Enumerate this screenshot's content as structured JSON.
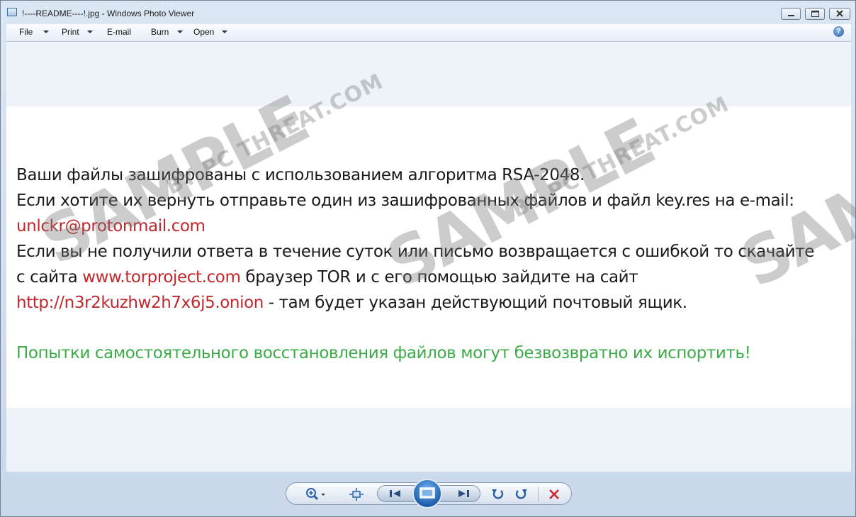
{
  "window": {
    "title": "!----README----!.jpg - Windows Photo Viewer"
  },
  "menu": {
    "items": [
      {
        "label": "File",
        "has_dropdown": true
      },
      {
        "label": "Print",
        "has_dropdown": true
      },
      {
        "label": "E-mail",
        "has_dropdown": false
      },
      {
        "label": "Burn",
        "has_dropdown": true
      },
      {
        "label": "Open",
        "has_dropdown": true
      }
    ],
    "help_icon": "help-icon"
  },
  "image_text": {
    "line1": "Ваши файлы зашифрованы с использованием алгоритма RSA-2048.",
    "line2": "Если хотите их вернуть отправьте один из зашифрованных файлов и файл key.res на e-mail:",
    "email": "unlckr@protonmail.com",
    "line4": "Если вы не получили ответа в течение суток или письмо возвращается с ошибкой то скачайте",
    "line5_prefix": "с сайта ",
    "line5_link": "www.torproject.com",
    "line5_suffix": " браузер  TOR и с его помощью зайдите на сайт",
    "onion_link": "http://n3r2kuzhw2h7x6j5.onion",
    "line6_suffix": " -  там будет указан действующий почтовый ящик.",
    "warning": "Попытки самостоятельного восстановления файлов могут безвозвратно их испортить!"
  },
  "watermark": {
    "main": "SAMPLE",
    "sub": "BY PC THREAT.COM"
  },
  "colors": {
    "link_red": "#c0282d",
    "warning_green": "#3aab47"
  },
  "controls": {
    "icons": [
      "zoom-icon",
      "fit-to-window-icon",
      "previous-icon",
      "slideshow-icon",
      "next-icon",
      "rotate-counterclockwise-icon",
      "rotate-clockwise-icon",
      "delete-icon"
    ]
  }
}
